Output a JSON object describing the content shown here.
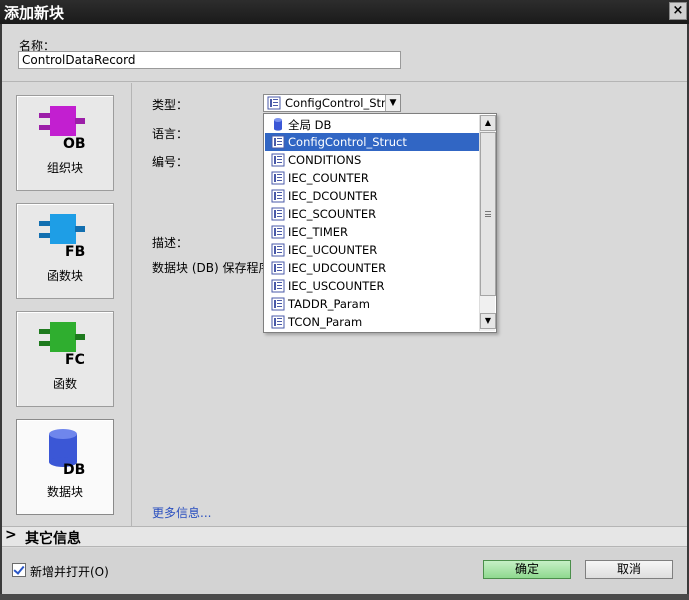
{
  "window": {
    "title": "添加新块",
    "close_label": "×"
  },
  "name": {
    "label": "名称：",
    "value": "ControlDataRecord"
  },
  "block_types": [
    {
      "label": "组织块",
      "badge": "OB",
      "color": "#c21fd0"
    },
    {
      "label": "函数块",
      "badge": "FB",
      "color": "#1e9ee6"
    },
    {
      "label": "函数",
      "badge": "FC",
      "color": "#2fae2f"
    },
    {
      "label": "数据块",
      "badge": "DB",
      "color": "#3b57d6"
    }
  ],
  "form": {
    "type_label": "类型：",
    "language_label": "语言：",
    "number_label": "编号：",
    "description_label": "描述：",
    "description_text": "数据块 (DB) 保存程序",
    "type_value": "ConfigControl_Struct"
  },
  "dropdown": {
    "items": [
      {
        "label": "全局 DB",
        "icon": "db-cylinder-icon"
      },
      {
        "label": "ConfigControl_Struct",
        "icon": "struct-icon",
        "selected": true
      },
      {
        "label": "CONDITIONS",
        "icon": "struct-icon"
      },
      {
        "label": "IEC_COUNTER",
        "icon": "struct-icon"
      },
      {
        "label": "IEC_DCOUNTER",
        "icon": "struct-icon"
      },
      {
        "label": "IEC_SCOUNTER",
        "icon": "struct-icon"
      },
      {
        "label": "IEC_TIMER",
        "icon": "struct-icon"
      },
      {
        "label": "IEC_UCOUNTER",
        "icon": "struct-icon"
      },
      {
        "label": "IEC_UDCOUNTER",
        "icon": "struct-icon"
      },
      {
        "label": "IEC_USCOUNTER",
        "icon": "struct-icon"
      },
      {
        "label": "TADDR_Param",
        "icon": "struct-icon"
      },
      {
        "label": "TCON_Param",
        "icon": "struct-icon"
      }
    ]
  },
  "more_info": "更多信息...",
  "other_info": {
    "chevron": ">",
    "label": "其它信息"
  },
  "footer": {
    "add_and_open": "新增并打开(O)",
    "ok": "确定",
    "cancel": "取消"
  }
}
